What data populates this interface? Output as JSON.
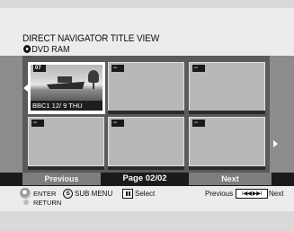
{
  "header": {
    "title": "DIRECT NAVIGATOR TITLE VIEW",
    "disc_icon": "disc-icon",
    "disc_label": "DVD RAM"
  },
  "grid": {
    "thumbnails": [
      {
        "badge": "07",
        "caption": "BBC1 12/ 9 THU",
        "selected": true
      },
      {
        "badge": "--"
      },
      {
        "badge": "--"
      },
      {
        "badge": "--"
      },
      {
        "badge": "--"
      },
      {
        "badge": "--"
      }
    ]
  },
  "pager": {
    "previous_label": "Previous",
    "page_label": "Page 02/02",
    "next_label": "Next"
  },
  "help": {
    "enter_label": "ENTER",
    "return_label": "RETURN",
    "sub_menu_key": "S",
    "sub_menu_label": "SUB MENU",
    "select_label": "Select",
    "previous_label": "Previous",
    "skip_icon_glyph": "I◀◀ ▶▶I",
    "next_label": "Next"
  },
  "colors": {
    "grid_background": "#5a5a5a",
    "thumbnail_empty": "#b8b8b8",
    "pager_button": "#7d7d7d",
    "header_band": "#ececec"
  }
}
